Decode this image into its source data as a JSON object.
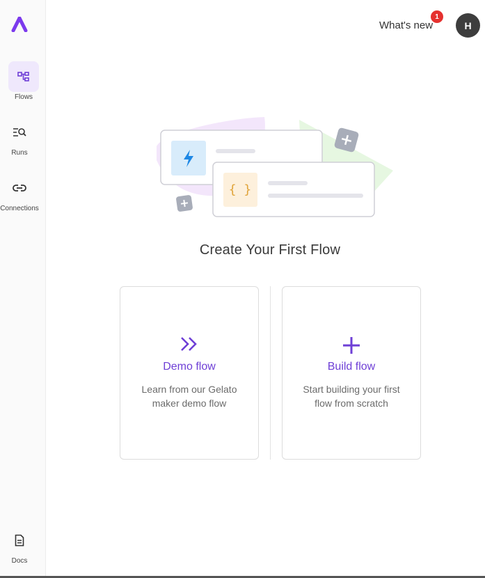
{
  "sidebar": {
    "items": [
      {
        "label": "Flows",
        "icon": "flows-icon",
        "active": true
      },
      {
        "label": "Runs",
        "icon": "runs-icon",
        "active": false
      },
      {
        "label": "Connections",
        "icon": "link-icon",
        "active": false
      }
    ],
    "footer": {
      "label": "Docs",
      "icon": "docs-icon"
    }
  },
  "header": {
    "whats_new_label": "What's new",
    "whats_new_badge": "1",
    "avatar_initial": "H"
  },
  "main": {
    "title": "Create Your First Flow",
    "cards": [
      {
        "title": "Demo flow",
        "description": "Learn from our Gelato maker demo flow",
        "icon": "double-chevron-right-icon"
      },
      {
        "title": "Build flow",
        "description": "Start building your first flow from scratch",
        "icon": "plus-icon"
      }
    ]
  },
  "colors": {
    "accent": "#6e3fd6",
    "active_nav_bg": "#efe8fc",
    "badge": "#e5312f",
    "avatar_bg": "#3d3d3d"
  }
}
